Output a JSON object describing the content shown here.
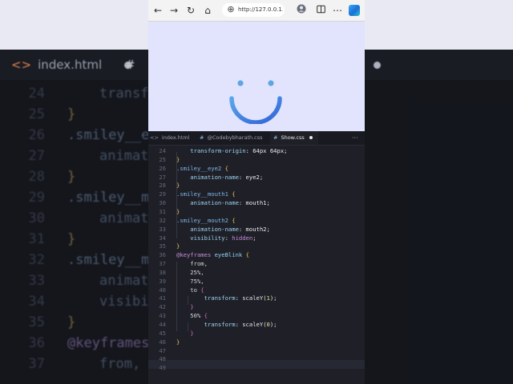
{
  "background": {
    "tabs": [
      {
        "label": "index.html"
      },
      {
        "label": "#"
      }
    ],
    "lines": [
      {
        "num": "24",
        "text": "transf",
        "indent": true,
        "kind": "prop"
      },
      {
        "num": "25",
        "text": "}",
        "indent": false,
        "kind": "br"
      },
      {
        "num": "26",
        "text": ".smiley__e",
        "indent": false,
        "kind": "sel"
      },
      {
        "num": "27",
        "text": "animat",
        "indent": true,
        "kind": "prop"
      },
      {
        "num": "28",
        "text": "}",
        "indent": false,
        "kind": "br"
      },
      {
        "num": "29",
        "text": ".smiley__mo",
        "indent": false,
        "kind": "sel"
      },
      {
        "num": "30",
        "text": "animat",
        "indent": true,
        "kind": "prop"
      },
      {
        "num": "31",
        "text": "}",
        "indent": false,
        "kind": "br"
      },
      {
        "num": "32",
        "text": ".smiley__m",
        "indent": false,
        "kind": "sel"
      },
      {
        "num": "33",
        "text": "animat",
        "indent": true,
        "kind": "prop"
      },
      {
        "num": "34",
        "text": "visibi",
        "indent": true,
        "kind": "prop"
      },
      {
        "num": "35",
        "text": "}",
        "indent": false,
        "kind": "br"
      },
      {
        "num": "36",
        "text": "@keyframes",
        "indent": false,
        "kind": "kw"
      },
      {
        "num": "37",
        "text": "from,",
        "indent": true,
        "kind": "prop"
      }
    ]
  },
  "browser": {
    "url": "http://127.0.0.1...",
    "icons": [
      "back-arrow-icon",
      "forward-arrow-icon",
      "refresh-icon",
      "home-icon",
      "site-info-icon",
      "profile-icon",
      "split-screen-icon",
      "copilot-icon"
    ]
  },
  "preview": {
    "background": "#e2e3fd",
    "eye_color": "#5ea6e3",
    "mouth_color_start": "#5aa6ec",
    "mouth_color_end": "#2f63d6"
  },
  "editor": {
    "tabs": [
      {
        "icon": "<>",
        "label": "index.html",
        "modified": false
      },
      {
        "icon": "#",
        "label": "@Codebybharath.css",
        "modified": false
      },
      {
        "icon": "#",
        "label": "Show.css",
        "modified": true
      }
    ],
    "more": "···",
    "lines": [
      {
        "num": "24",
        "tokens": [
          {
            "t": "    transform-origin",
            "c": "prop"
          },
          {
            "t": ": 64px 64px;",
            "c": "val"
          }
        ]
      },
      {
        "num": "25",
        "tokens": [
          {
            "t": "}",
            "c": "brace"
          }
        ]
      },
      {
        "num": "26",
        "tokens": [
          {
            "t": ".smiley__eye2 ",
            "c": "sel"
          },
          {
            "t": "{",
            "c": "brace"
          }
        ]
      },
      {
        "num": "27",
        "tokens": [
          {
            "t": "    animation-name",
            "c": "prop"
          },
          {
            "t": ": eye2;",
            "c": "val"
          }
        ]
      },
      {
        "num": "28",
        "tokens": [
          {
            "t": "}",
            "c": "brace"
          }
        ]
      },
      {
        "num": "29",
        "tokens": [
          {
            "t": ".smiley__mouth1 ",
            "c": "sel"
          },
          {
            "t": "{",
            "c": "brace"
          }
        ]
      },
      {
        "num": "30",
        "tokens": [
          {
            "t": "    animation-name",
            "c": "prop"
          },
          {
            "t": ": mouth1;",
            "c": "val"
          }
        ]
      },
      {
        "num": "31",
        "tokens": [
          {
            "t": "}",
            "c": "brace"
          }
        ]
      },
      {
        "num": "32",
        "tokens": [
          {
            "t": ".smiley__mouth2 ",
            "c": "sel"
          },
          {
            "t": "{",
            "c": "brace"
          }
        ]
      },
      {
        "num": "33",
        "tokens": [
          {
            "t": "    animation-name",
            "c": "prop"
          },
          {
            "t": ": mouth2;",
            "c": "val"
          }
        ]
      },
      {
        "num": "34",
        "tokens": [
          {
            "t": "    visibility",
            "c": "prop"
          },
          {
            "t": ": ",
            "c": "val"
          },
          {
            "t": "hidden",
            "c": "kw"
          },
          {
            "t": ";",
            "c": "val"
          }
        ]
      },
      {
        "num": "35",
        "tokens": [
          {
            "t": "}",
            "c": "brace"
          }
        ]
      },
      {
        "num": "36",
        "tokens": [
          {
            "t": "@keyframes ",
            "c": "kw"
          },
          {
            "t": "eyeBlink ",
            "c": "name"
          },
          {
            "t": "{",
            "c": "brace"
          }
        ]
      },
      {
        "num": "37",
        "tokens": [
          {
            "t": "    from,",
            "c": "plain"
          }
        ]
      },
      {
        "num": "38",
        "tokens": [
          {
            "t": "    25%,",
            "c": "plain"
          }
        ]
      },
      {
        "num": "39",
        "tokens": [
          {
            "t": "    75%,",
            "c": "plain"
          }
        ]
      },
      {
        "num": "40",
        "tokens": [
          {
            "t": "    to ",
            "c": "plain"
          },
          {
            "t": "{",
            "c": "brace2"
          }
        ]
      },
      {
        "num": "41",
        "tokens": [
          {
            "t": "        transform",
            "c": "prop"
          },
          {
            "t": ": scaleY(",
            "c": "val"
          },
          {
            "t": "1",
            "c": "fn"
          },
          {
            "t": ");",
            "c": "val"
          }
        ]
      },
      {
        "num": "42",
        "tokens": [
          {
            "t": "    }",
            "c": "brace2"
          }
        ]
      },
      {
        "num": "43",
        "tokens": [
          {
            "t": "    50% ",
            "c": "plain"
          },
          {
            "t": "{",
            "c": "brace2"
          }
        ]
      },
      {
        "num": "44",
        "tokens": [
          {
            "t": "        transform",
            "c": "prop"
          },
          {
            "t": ": scaleY(",
            "c": "val"
          },
          {
            "t": "0",
            "c": "fn"
          },
          {
            "t": ");",
            "c": "val"
          }
        ]
      },
      {
        "num": "45",
        "tokens": [
          {
            "t": "    }",
            "c": "brace2"
          }
        ]
      },
      {
        "num": "46",
        "tokens": [
          {
            "t": "}",
            "c": "brace"
          }
        ]
      },
      {
        "num": "47",
        "tokens": []
      },
      {
        "num": "48",
        "tokens": []
      },
      {
        "num": "49",
        "tokens": []
      }
    ]
  }
}
